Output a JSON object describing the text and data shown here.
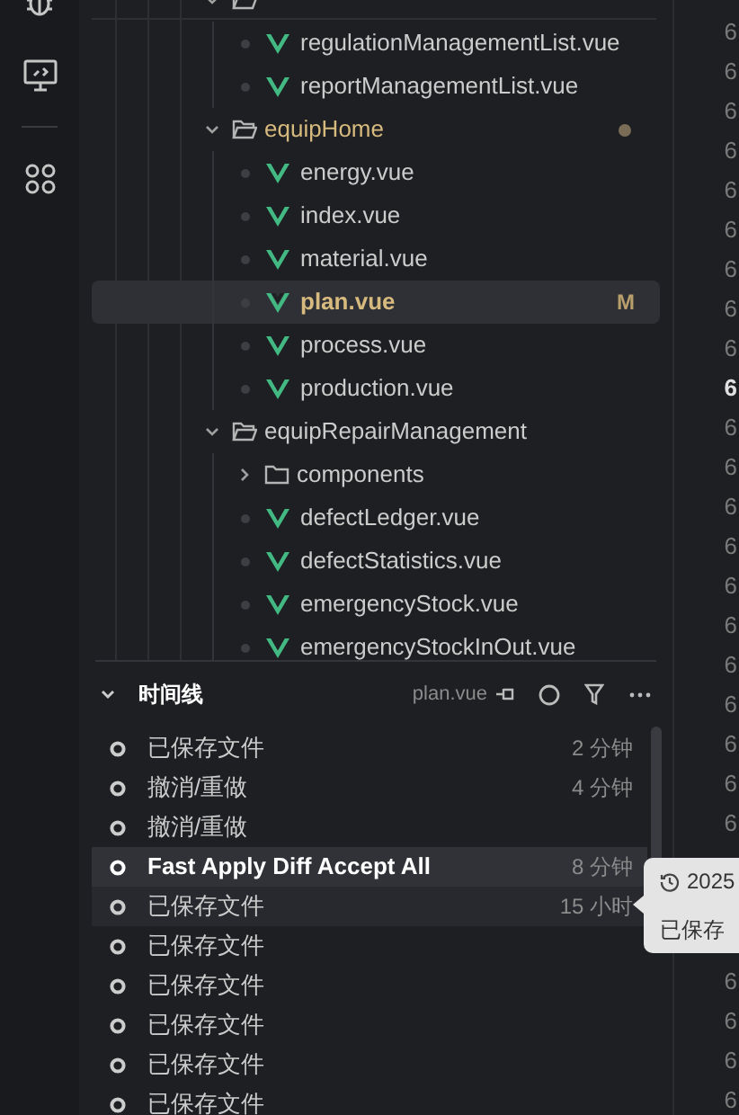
{
  "tree": [
    {
      "kind": "folder",
      "expanded": true,
      "modified": false,
      "selected": false,
      "children": [
        {
          "kind": "file",
          "label": "regulationManagementList.vue",
          "selected": false
        },
        {
          "kind": "file",
          "label": "reportManagementList.vue",
          "selected": false
        }
      ]
    },
    {
      "kind": "folder",
      "label": "equipHome",
      "expanded": true,
      "modified": true,
      "selected": false,
      "children": [
        {
          "kind": "file",
          "label": "energy.vue",
          "selected": false
        },
        {
          "kind": "file",
          "label": "index.vue",
          "selected": false
        },
        {
          "kind": "file",
          "label": "material.vue",
          "selected": false
        },
        {
          "kind": "file",
          "label": "plan.vue",
          "selected": true,
          "badge": "M"
        },
        {
          "kind": "file",
          "label": "process.vue",
          "selected": false
        },
        {
          "kind": "file",
          "label": "production.vue",
          "selected": false
        }
      ]
    },
    {
      "kind": "folder",
      "label": "equipRepairManagement",
      "expanded": true,
      "modified": false,
      "selected": false,
      "children": [
        {
          "kind": "folder",
          "label": "components",
          "expanded": false,
          "modified": false,
          "selected": false
        },
        {
          "kind": "file",
          "label": "defectLedger.vue",
          "selected": false
        },
        {
          "kind": "file",
          "label": "defectStatistics.vue",
          "selected": false
        },
        {
          "kind": "file",
          "label": "emergencyStock.vue",
          "selected": false
        },
        {
          "kind": "file",
          "label": "emergencyStockInOut.vue",
          "selected": false
        }
      ]
    }
  ],
  "timeline": {
    "title": "时间线",
    "expanded": true,
    "file": "plan.vue",
    "items": [
      {
        "label": "已保存文件",
        "time": "2 分钟",
        "selected": false,
        "hovered": false
      },
      {
        "label": "撤消/重做",
        "time": "4 分钟",
        "selected": false,
        "hovered": false
      },
      {
        "label": "撤消/重做",
        "selected": false,
        "hovered": false
      },
      {
        "label": "Fast Apply Diff Accept All",
        "time": "8 分钟",
        "selected": true,
        "hovered": false
      },
      {
        "label": "已保存文件",
        "time": "15 小时",
        "selected": false,
        "hovered": true
      },
      {
        "label": "已保存文件",
        "selected": false,
        "hovered": false
      },
      {
        "label": "已保存文件",
        "selected": false,
        "hovered": false
      },
      {
        "label": "已保存文件",
        "selected": false,
        "hovered": false
      },
      {
        "label": "已保存文件",
        "selected": false,
        "hovered": false
      },
      {
        "label": "已保存文件",
        "selected": false,
        "hovered": false
      }
    ]
  },
  "tooltip": {
    "date": "2025",
    "text": "已保存"
  },
  "line_numbers": {
    "above": [
      {
        "text": "6",
        "current": false
      },
      {
        "text": "6",
        "current": false
      },
      {
        "text": "6",
        "current": false
      },
      {
        "text": "6",
        "current": false
      },
      {
        "text": "6",
        "current": false
      },
      {
        "text": "6",
        "current": false
      },
      {
        "text": "6",
        "current": false
      },
      {
        "text": "6",
        "current": false
      },
      {
        "text": "6",
        "current": false
      },
      {
        "text": "6",
        "current": true
      },
      {
        "text": "6",
        "current": false
      },
      {
        "text": "6",
        "current": false
      },
      {
        "text": "6",
        "current": false
      },
      {
        "text": "6",
        "current": false
      },
      {
        "text": "6",
        "current": false
      },
      {
        "text": "6",
        "current": false
      },
      {
        "text": "6",
        "current": false
      },
      {
        "text": "6",
        "current": false
      },
      {
        "text": "6",
        "current": false
      },
      {
        "text": "6",
        "current": false
      },
      {
        "text": "6",
        "current": false
      }
    ],
    "below": [
      {
        "text": "6",
        "current": false
      },
      {
        "text": "6",
        "current": false
      },
      {
        "text": "6",
        "current": false
      },
      {
        "text": "6",
        "current": false
      }
    ]
  }
}
